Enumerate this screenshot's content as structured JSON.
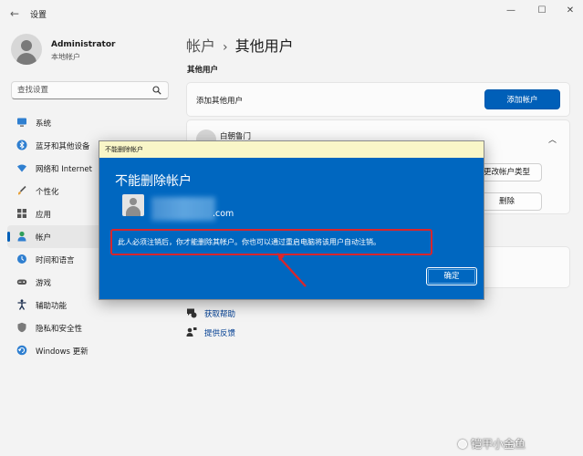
{
  "titlebar": {
    "back_glyph": "←",
    "app_title": "设置",
    "minimize_glyph": "—",
    "maximize_glyph": "☐",
    "close_glyph": "✕"
  },
  "profile": {
    "name": "Administrator",
    "subtitle": "本地帐户"
  },
  "search": {
    "placeholder": "查找设置"
  },
  "sidebar": {
    "items": [
      {
        "label": "系统",
        "icon": "monitor-icon"
      },
      {
        "label": "蓝牙和其他设备",
        "icon": "bluetooth-icon"
      },
      {
        "label": "网络和 Internet",
        "icon": "wifi-icon"
      },
      {
        "label": "个性化",
        "icon": "brush-icon"
      },
      {
        "label": "应用",
        "icon": "apps-icon"
      },
      {
        "label": "帐户",
        "icon": "person-icon",
        "active": true
      },
      {
        "label": "时间和语言",
        "icon": "clock-globe-icon"
      },
      {
        "label": "游戏",
        "icon": "gamepad-icon"
      },
      {
        "label": "辅助功能",
        "icon": "accessibility-icon"
      },
      {
        "label": "隐私和安全性",
        "icon": "shield-icon"
      },
      {
        "label": "Windows 更新",
        "icon": "update-icon"
      }
    ]
  },
  "main": {
    "breadcrumb_parent": "帐户",
    "breadcrumb_sep": "›",
    "breadcrumb_current": "其他用户",
    "section_title": "其他用户",
    "add_user_label": "添加其他用户",
    "add_account_button": "添加帐户",
    "user_name": "白朝鲁门",
    "change_type_button": "更改帐户类型",
    "delete_button": "删除",
    "chevron_glyph": "︿",
    "help_links": [
      {
        "label": "获取帮助",
        "icon": "help-chat-icon"
      },
      {
        "label": "提供反馈",
        "icon": "feedback-icon"
      }
    ]
  },
  "dialog": {
    "titlebar_text": "不能删除帐户",
    "heading": "不能删除帐户",
    "email_suffix": ".com",
    "message": "此人必须注销后，你才能删除其帐户。你也可以通过重启电脑将该用户自动注销。",
    "ok_button": "确定"
  },
  "watermark": {
    "text": "铠甲小金鱼"
  },
  "colors": {
    "accent": "#005fb8",
    "dialog_bg": "#0067c0",
    "highlight_red": "#d9262c"
  }
}
